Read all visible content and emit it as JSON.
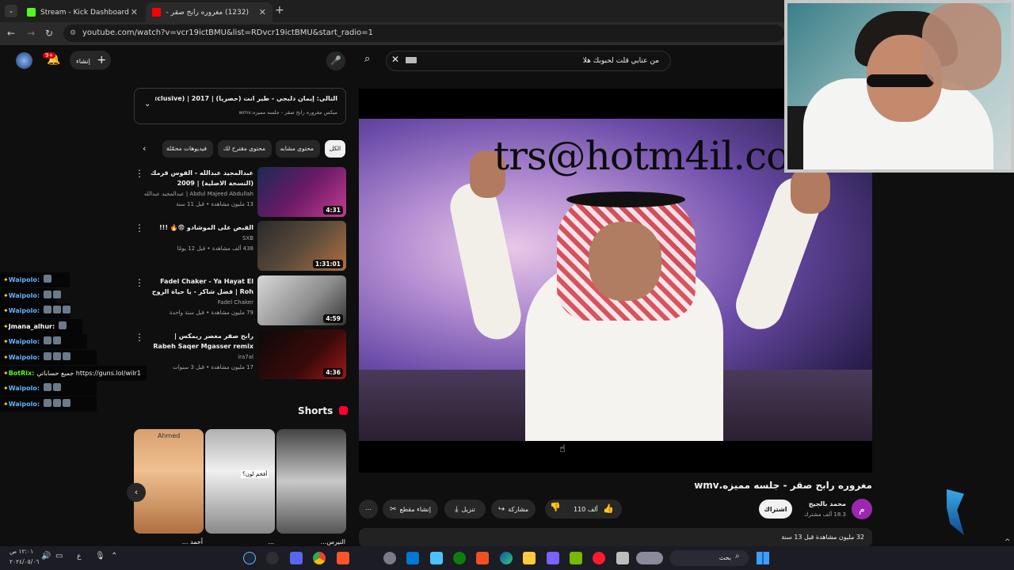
{
  "browser": {
    "tabs": [
      {
        "label": "Stream - Kick Dashboard"
      },
      {
        "label": "(1232) مغروره رابح صقر - جلـ"
      }
    ],
    "url": "youtube.com/watch?v=vcr19ictBMU&list=RDvcr19ictBMU&start_radio=1"
  },
  "header": {
    "create_label": "إنشاء",
    "notif_count": "9+",
    "search_value": "من عنابي قلت لحبوبك هلا"
  },
  "overlay_text": "trs@hotm4il.com",
  "video": {
    "title": "مغروره رابح صقر - جلسه مميزه.wmv",
    "channel": "محمد بالجيج",
    "channel_initial": "م",
    "subs": "18.3 ألف مشترك",
    "subscribe": "اشتراك",
    "likes": "110 ألف",
    "share": "مشاركة",
    "download": "تنزيل",
    "clip": "إنشاء مقطع",
    "description_meta": "32 مليون مشاهدة قبل 13 سنة"
  },
  "sidebar": {
    "next_title": "التالي: إيمان دلبجي - طير انت (حصرياً) | 2017 | Ent (Exclusive) ...",
    "next_sub": "ميكس مغروره رابح صقر - جلسه مميزه.wmv",
    "chips": [
      "الكل",
      "محتوى مشابه",
      "محتوى مقترح لك",
      "فيديوهات محمّلة"
    ],
    "videos": [
      {
        "title": "عبدالمجيد عبدالله - الفوس قرمك (النسخة الاصلية) | 2009",
        "channel": "Abdul Majeed Abdullah | عبدالمجيد عبدالله",
        "meta": "13 مليون مشاهدة • قبل 11 سنة",
        "duration": "4:31"
      },
      {
        "title": "القبض على الموشادو 😨🔥 !!!",
        "channel": "SXB",
        "meta": "438 ألف مشاهدة • قبل 12 يومًا",
        "duration": "1:31:01"
      },
      {
        "title": "Fadel Chaker - Ya Hayat El Roh | فضل شاكر - يا حياة الروح",
        "channel": "Fadel Chaker",
        "meta": "79 مليون مشاهدة • قبل سنة واحدة",
        "duration": "4:59"
      },
      {
        "title": "رابح صقر مغصر ريمكس | Rabeh Saqer Mgasser remix",
        "channel": "ira7al",
        "meta": "17 مليون مشاهدة • قبل 3 سنوات",
        "duration": "4:36"
      }
    ],
    "shorts_label": "Shorts",
    "shorts": [
      {
        "caption": "Ahmed",
        "bottom": "أحمد ..."
      },
      {
        "caption": "أفخم لون؟",
        "bottom": "..."
      },
      {
        "caption": "",
        "bottom": "النيرس..."
      }
    ]
  },
  "chat": [
    {
      "user": "Waipolo:",
      "text": "",
      "color": "#5fb3ff"
    },
    {
      "user": "Waipolo:",
      "text": "",
      "color": "#5fb3ff"
    },
    {
      "user": "Waipolo:",
      "text": "",
      "color": "#5fb3ff"
    },
    {
      "user": "Jmana_alhur:",
      "text": "",
      "color": "#ffffff"
    },
    {
      "user": "Waipolo:",
      "text": "",
      "color": "#5fb3ff"
    },
    {
      "user": "Waipolo:",
      "text": "",
      "color": "#5fb3ff"
    },
    {
      "user": "BotRix:",
      "text": "جميع حساباتي https://guns.lol/wilr1",
      "color": "#53fc18"
    },
    {
      "user": "Waipolo:",
      "text": "",
      "color": "#5fb3ff"
    },
    {
      "user": "Waipolo:",
      "text": "",
      "color": "#5fb3ff"
    }
  ],
  "taskbar": {
    "search_placeholder": "بحث",
    "time": "١٢:٠١ ص",
    "date": "٢٠٢٤/٠٥/٠٦"
  }
}
